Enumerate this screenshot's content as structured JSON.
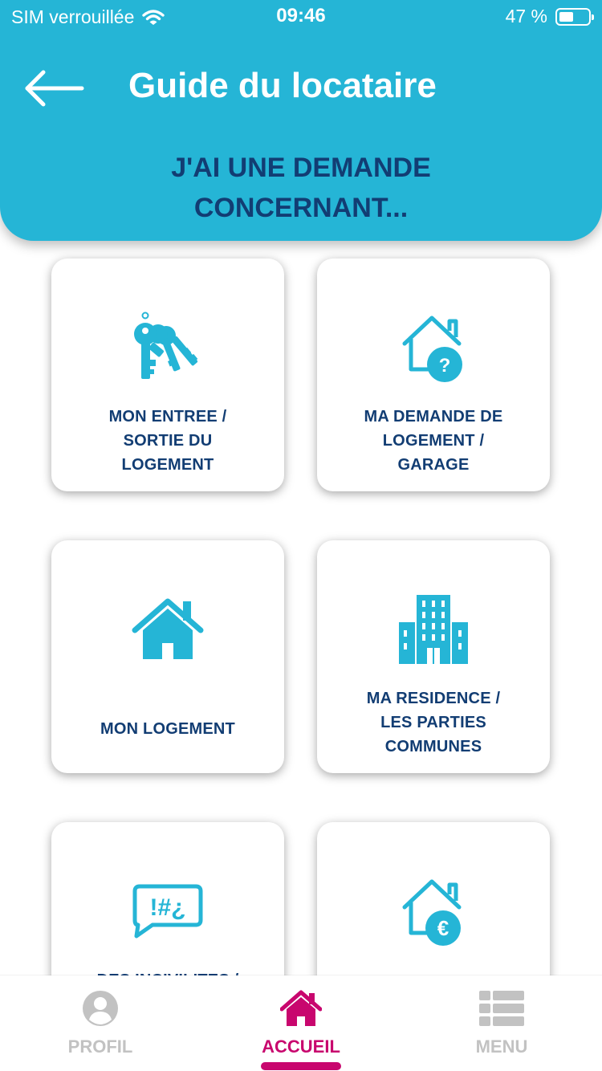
{
  "status_bar": {
    "carrier": "SIM verrouillée",
    "time": "09:46",
    "battery": "47 %",
    "battery_level": 0.47
  },
  "header": {
    "title": "Guide du locataire",
    "subtitle_line1": "J'AI UNE DEMANDE",
    "subtitle_line2": "CONCERNANT..."
  },
  "cards": [
    {
      "icon": "keys-icon",
      "lines": [
        "MON ENTREE /",
        "SORTIE DU",
        "LOGEMENT"
      ]
    },
    {
      "icon": "house-question-icon",
      "lines": [
        "MA DEMANDE DE",
        "LOGEMENT /",
        "GARAGE"
      ]
    },
    {
      "icon": "house-icon",
      "lines": [
        "MON LOGEMENT"
      ]
    },
    {
      "icon": "building-icon",
      "lines": [
        "MA RESIDENCE /",
        "LES PARTIES",
        "COMMUNES"
      ]
    },
    {
      "icon": "speech-bubble-icon",
      "bubble_text": "!#¿",
      "lines": [
        "DES INCIVILITES /"
      ]
    },
    {
      "icon": "house-euro-icon",
      "badge": "€",
      "lines": []
    }
  ],
  "house_question_badge": "?",
  "bottom_nav": {
    "items": [
      {
        "label": "PROFIL",
        "icon": "user-icon",
        "active": false
      },
      {
        "label": "ACCUEIL",
        "icon": "home-icon",
        "active": true
      },
      {
        "label": "MENU",
        "icon": "list-icon",
        "active": false
      }
    ]
  },
  "colors": {
    "header_bg": "#25b5d6",
    "dark_blue": "#123d73",
    "icon_blue": "#25b5d6",
    "accent": "#c8066e",
    "inactive": "#c2c2c2"
  }
}
